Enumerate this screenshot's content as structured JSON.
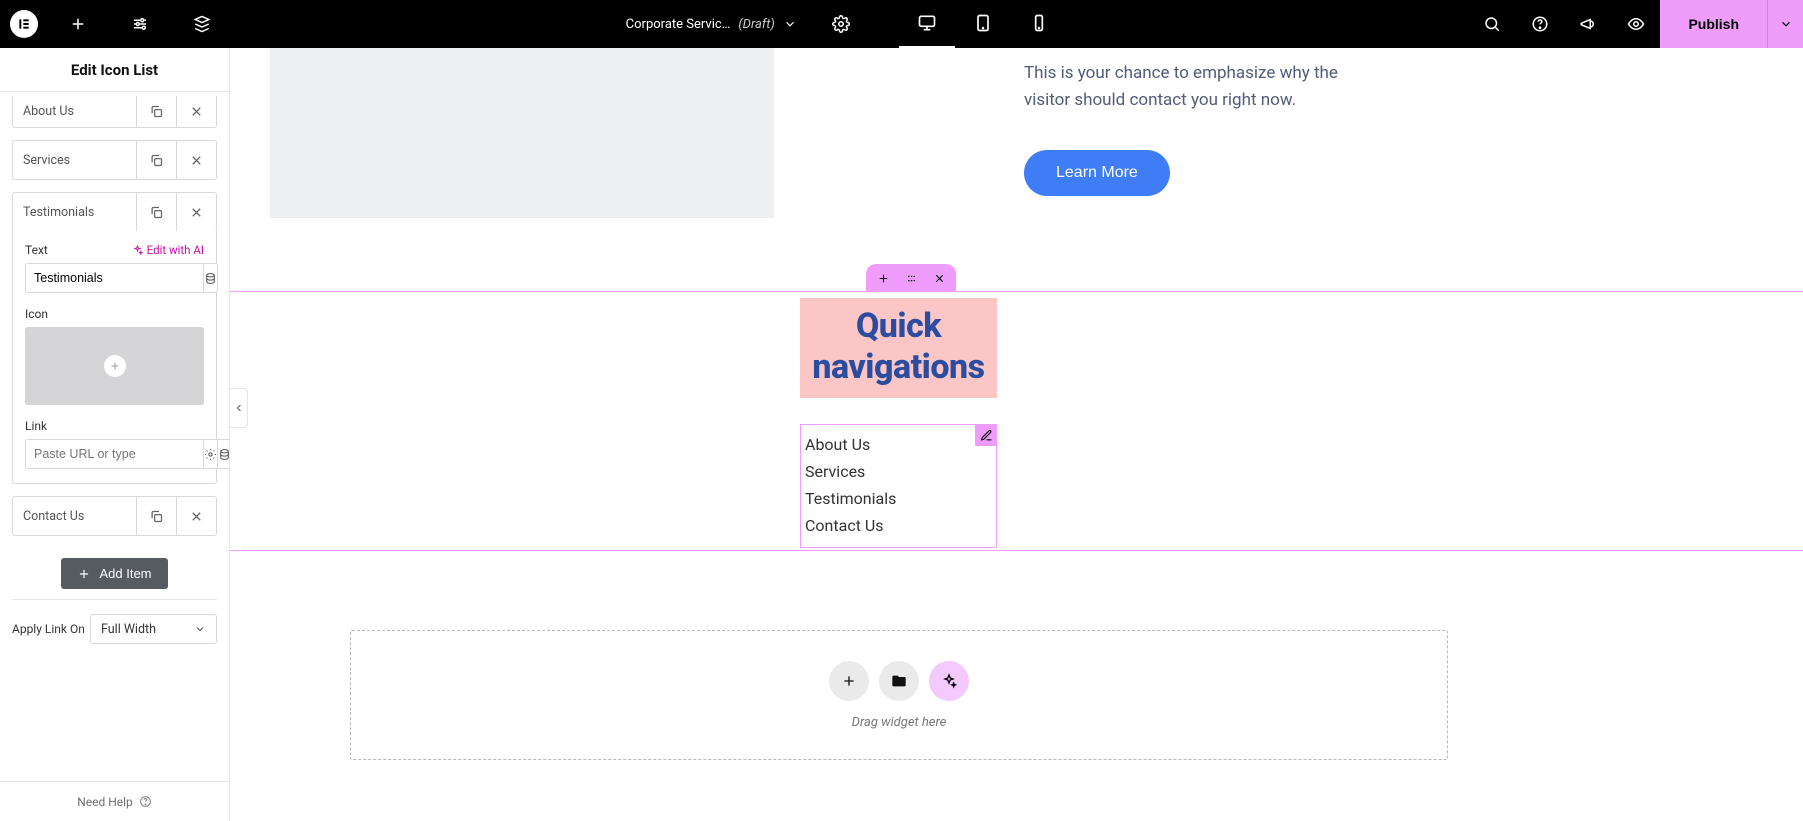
{
  "topbar": {
    "title": "Corporate Servic…",
    "status": "(Draft)",
    "publish": "Publish"
  },
  "panel": {
    "title": "Edit Icon List",
    "items": [
      {
        "label": "About Us"
      },
      {
        "label": "Services"
      },
      {
        "label": "Testimonials"
      },
      {
        "label": "Contact Us"
      }
    ],
    "text_label": "Text",
    "ai_label": "Edit with AI",
    "text_value": "Testimonials",
    "icon_label": "Icon",
    "link_label": "Link",
    "link_placeholder": "Paste URL or type",
    "add_item": "Add Item",
    "apply_link_label": "Apply Link On",
    "apply_link_value": "Full Width",
    "help": "Need Help"
  },
  "canvas": {
    "cta_text": "This is your chance to emphasize why the visitor should contact you right now.",
    "cta_button": "Learn More",
    "qn_title_line1": "Quick",
    "qn_title_line2": "navigations",
    "list": [
      "About Us",
      "Services",
      "Testimonials",
      "Contact Us"
    ],
    "dropzone_text": "Drag widget here"
  }
}
